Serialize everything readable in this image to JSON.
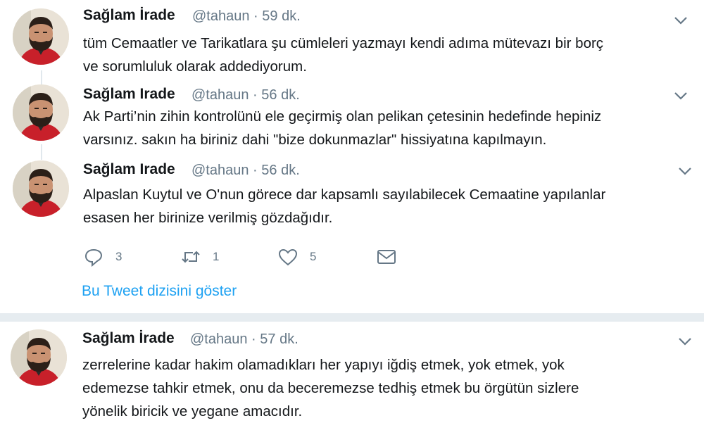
{
  "tweets": [
    {
      "name": "Sağlam İrade",
      "handle": "@tahaun",
      "time": "59 dk.",
      "line1": "tüm Cemaatler ve Tarikatlara şu cümleleri yazmayı kendi adıma mütevazı bir borç",
      "line2": "ve sorumluluk olarak addediyorum."
    },
    {
      "name": "Sağlam Irade",
      "handle": "@tahaun",
      "time": "56 dk.",
      "line1": "Ak Parti’nin zihin kontrolünü ele geçirmiş olan pelikan çetesinin hedefinde hepiniz",
      "line2": "varsınız. sakın ha biriniz dahi \"bize dokunmazlar\" hissiyatına kapılmayın."
    },
    {
      "name": "Sağlam Irade",
      "handle": "@tahaun",
      "time": "56 dk.",
      "line1": "Alpaslan Kuytul ve O'nun görece dar kapsamlı sayılabilecek Cemaatine yapılanlar",
      "line2": "esasen her birinize verilmiş gözdağıdır."
    },
    {
      "name": "Sağlam İrade",
      "handle": "@tahaun",
      "time": "57 dk.",
      "line1": "zerrelerine kadar hakim olamadıkları her yapıyı iğdiş etmek, yok etmek, yok",
      "line2": "edemezse tahkir etmek, onu da beceremezse tedhiş etmek bu örgütün sizlere",
      "line3": "yönelik biricik ve yegane amacıdır."
    }
  ],
  "actions": {
    "reply_count": "3",
    "retweet_count": "1",
    "like_count": "5"
  },
  "show_thread": "Bu Tweet dizisini göster",
  "separator": "·",
  "icons": {
    "reply": "reply-icon",
    "retweet": "retweet-icon",
    "like": "heart-icon",
    "dm": "envelope-icon",
    "menu": "chevron-down-icon"
  },
  "colors": {
    "link": "#1da1f2",
    "muted": "#657786",
    "text": "#14171a",
    "divider": "#e6ecf0"
  }
}
